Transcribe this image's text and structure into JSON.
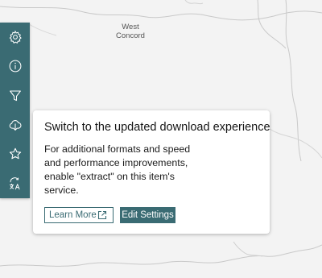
{
  "map": {
    "place_label_lines": [
      "West",
      "Concord"
    ]
  },
  "toolbar": {
    "tools": [
      {
        "icon": "gear-icon"
      },
      {
        "icon": "info-icon"
      },
      {
        "icon": "filter-icon"
      },
      {
        "icon": "cloud-download-icon"
      },
      {
        "icon": "star-icon"
      },
      {
        "icon": "translate-icon"
      }
    ],
    "background": "#3a6b73"
  },
  "popup": {
    "title": "Switch to the updated download experience",
    "body_lines": [
      "For additional formats and speed",
      "and performance improvements,",
      "enable \"extract\" on this item's",
      "service."
    ],
    "learn_more_label": "Learn More",
    "edit_settings_label": "Edit Settings"
  },
  "colors": {
    "accent": "#3a6b73",
    "map_background": "#f3f3f3"
  }
}
